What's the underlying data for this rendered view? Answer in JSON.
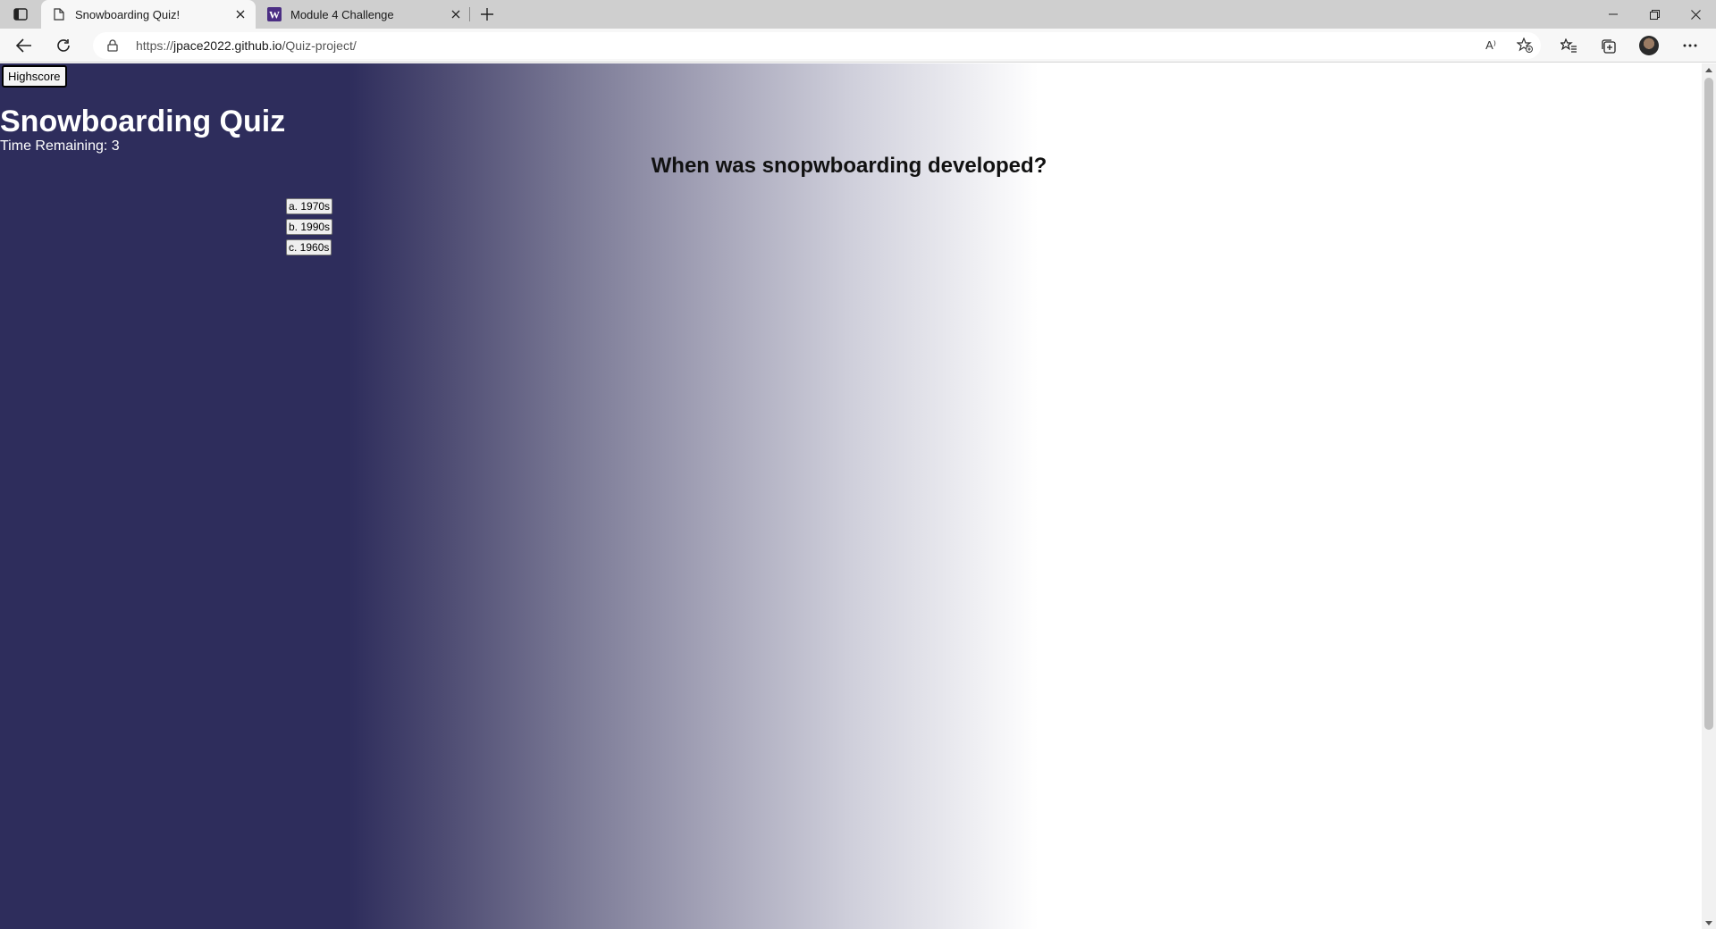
{
  "browser": {
    "tabs": [
      {
        "title": "Snowboarding Quiz!",
        "active": true,
        "favicon": "page-icon"
      },
      {
        "title": "Module 4 Challenge",
        "active": false,
        "favicon": "w-logo-icon"
      }
    ],
    "address": {
      "scheme": "https://",
      "host": "jpace2022.github.io",
      "path": "/Quiz-project/"
    },
    "read_aloud_label": "A⁾"
  },
  "page": {
    "highscore_label": "Highscore",
    "title": "Snowboarding Quiz",
    "timer_text": "Time Remaining: 3",
    "question": "When was snopwboarding developed?",
    "answers": [
      "a. 1970s",
      "b. 1990s",
      "c. 1960s"
    ],
    "background_colors": {
      "dark": "#2e2d5c",
      "light": "#ffffff"
    }
  }
}
